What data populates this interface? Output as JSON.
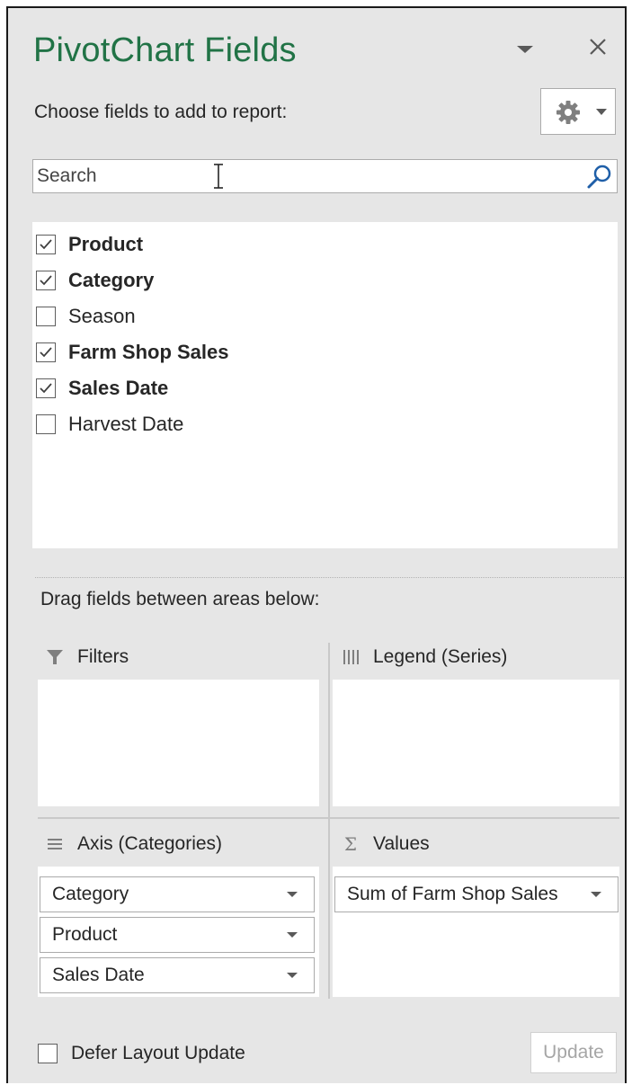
{
  "panel": {
    "title": "PivotChart Fields",
    "subtitle": "Choose fields to add to report:",
    "accent_color": "#217346",
    "title_menu_icon": "chevron-down-icon",
    "close_icon": "close-icon",
    "tools_icon": "gear-icon"
  },
  "search": {
    "placeholder": "Search",
    "value": "",
    "icon": "search-icon"
  },
  "fields": [
    {
      "label": "Product",
      "checked": true
    },
    {
      "label": "Category",
      "checked": true
    },
    {
      "label": "Season",
      "checked": false
    },
    {
      "label": "Farm Shop Sales",
      "checked": true
    },
    {
      "label": "Sales Date",
      "checked": true
    },
    {
      "label": "Harvest Date",
      "checked": false
    }
  ],
  "areas": {
    "instruction": "Drag fields between areas below:",
    "filters": {
      "label": "Filters",
      "icon": "filter-icon",
      "items": []
    },
    "legend": {
      "label": "Legend (Series)",
      "icon": "columns-icon",
      "items": []
    },
    "axis": {
      "label": "Axis (Categories)",
      "icon": "rows-icon",
      "items": [
        "Category",
        "Product",
        "Sales Date"
      ]
    },
    "values": {
      "label": "Values",
      "icon": "sigma-icon",
      "symbol": "Σ",
      "items": [
        "Sum of Farm Shop Sales"
      ]
    }
  },
  "footer": {
    "defer_label": "Defer Layout Update",
    "defer_checked": false,
    "update_label": "Update"
  }
}
